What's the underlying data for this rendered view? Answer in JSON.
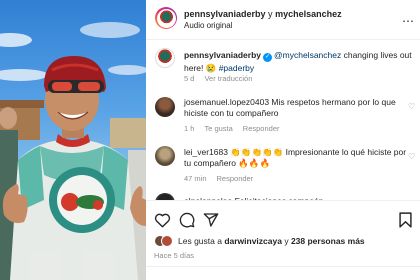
{
  "header": {
    "account": "pennsylvaniaderby",
    "connector": " y ",
    "coauthor": "mychelsanchez",
    "audio": "Audio original",
    "more_icon": "ellipsis-icon"
  },
  "caption": {
    "username": "pennsylvaniaderby",
    "mention": "@mychelsanchez",
    "text": " changing lives out here! 😢 ",
    "hashtag": "#paderby",
    "age": "5 d",
    "translate": "Ver traducción"
  },
  "comments": [
    {
      "username": "josemanuel.lopez0403",
      "text": " Mis respetos hermano por lo que hiciste con tu compañero",
      "age": "1 h",
      "likes": "Te gusta",
      "reply": "Responder"
    },
    {
      "username": "lei_ver1683",
      "text": " 👏👏👏👏👏 Impresionante lo qué hiciste por tu compañero 🔥🔥🔥",
      "age": "47 min",
      "reply": "Responder"
    },
    {
      "username": "elpelonpelao",
      "text": " Felicitaciones campeón"
    }
  ],
  "actions": {
    "like_icon": "heart-icon",
    "comment_icon": "comment-icon",
    "share_icon": "share-icon",
    "save_icon": "bookmark-icon"
  },
  "likes": {
    "prefix": "Les gusta a ",
    "user": "darwinvizcaya",
    "middle": " y ",
    "others": "238 personas más"
  },
  "time": "Hace 5 días",
  "colors": {
    "link": "#00376b",
    "verified": "#0095f6",
    "secondary": "#8e8e8e"
  }
}
